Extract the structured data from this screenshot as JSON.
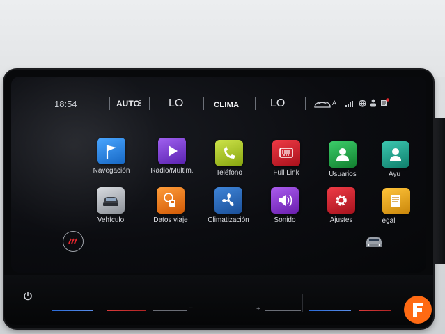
{
  "status_bar": {
    "time": "18:54",
    "auto_label": "AUTO",
    "temp_left": "LO",
    "clima_label": "CLIMA",
    "temp_right": "LO",
    "car_mode": "A"
  },
  "apps": [
    {
      "name": "navigation",
      "label": "Navegación",
      "color": "#1e7fd8",
      "icon": "flag-icon"
    },
    {
      "name": "radio",
      "label": "Radio/Multim.",
      "color": "#7a3ad0",
      "icon": "play-icon"
    },
    {
      "name": "phone",
      "label": "Teléfono",
      "color": "#a8c61a",
      "icon": "phone-icon"
    },
    {
      "name": "full-link",
      "label": "Full Link",
      "color": "#d21d2b",
      "icon": "keyboard-icon"
    },
    {
      "name": "users",
      "label": "Usuarios",
      "color": "#1ea44a",
      "icon": "user-icon"
    },
    {
      "name": "help",
      "label": "Ayu",
      "color": "#16a08a",
      "icon": "help-icon"
    },
    {
      "name": "vehicle",
      "label": "Vehículo",
      "color": "#9aa0a8",
      "icon": "car-icon"
    },
    {
      "name": "trip-data",
      "label": "Datos viaje",
      "color": "#f07a12",
      "icon": "fuel-icon"
    },
    {
      "name": "climate",
      "label": "Climatización",
      "color": "#2a6ab8",
      "icon": "fan-icon"
    },
    {
      "name": "sound",
      "label": "Sonido",
      "color": "#8a3ac8",
      "icon": "speaker-icon"
    },
    {
      "name": "settings",
      "label": "Ajustes",
      "color": "#d4202c",
      "icon": "gear-icon"
    },
    {
      "name": "legal",
      "label": "Legal",
      "color": "#e6a418",
      "icon": "document-icon"
    }
  ],
  "brand_logo_letter": "F",
  "colors": {
    "accent": "#ff6a13"
  }
}
